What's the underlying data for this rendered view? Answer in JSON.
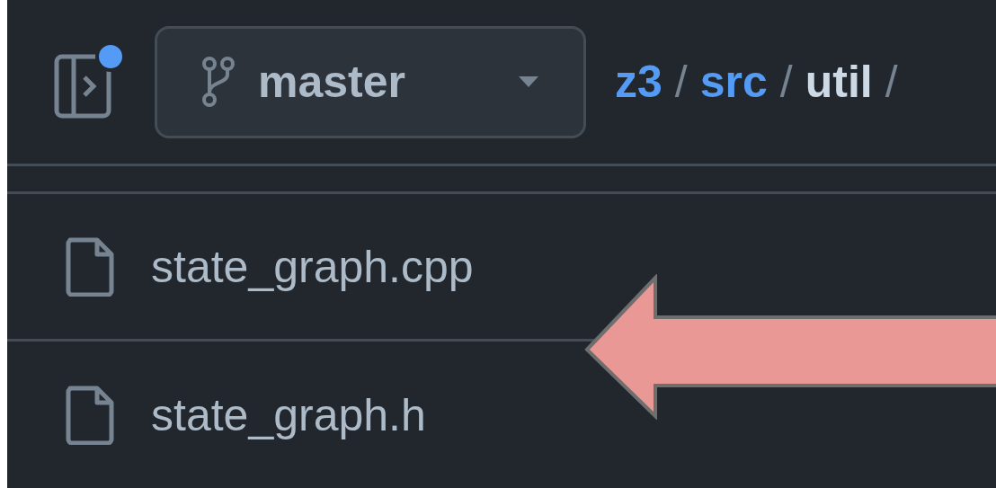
{
  "header": {
    "notification": true,
    "branch": {
      "name": "master"
    },
    "breadcrumb": [
      {
        "label": "z3",
        "kind": "link",
        "separator": "/"
      },
      {
        "label": "src",
        "kind": "link",
        "separator": "/"
      },
      {
        "label": "util",
        "kind": "current",
        "separator": "/"
      }
    ]
  },
  "files": [
    {
      "name": "state_graph.cpp"
    },
    {
      "name": "state_graph.h"
    }
  ]
}
